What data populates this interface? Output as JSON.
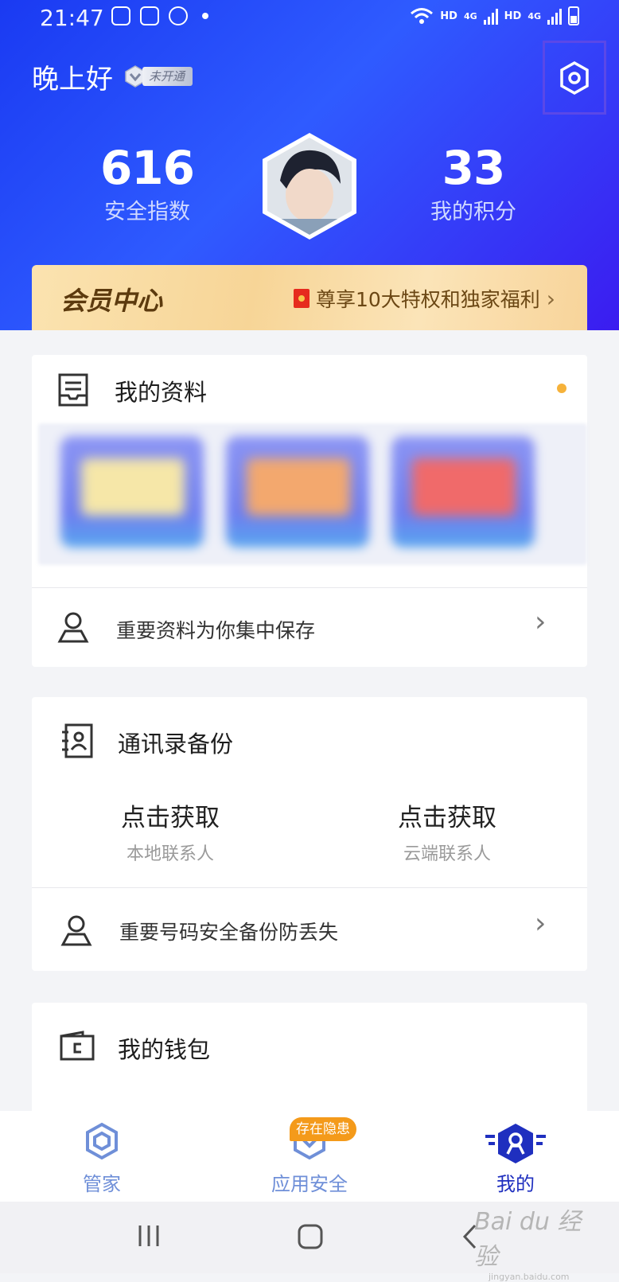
{
  "status_bar": {
    "time": "21:47",
    "network_labels": [
      "HD",
      "4G",
      "HD",
      "4G"
    ]
  },
  "header": {
    "greeting": "晚上好",
    "vip_status": "未开通",
    "settings_icon": "settings-hexagon-icon"
  },
  "stats": {
    "security_score": "616",
    "security_label": "安全指数",
    "points": "33",
    "points_label": "我的积分"
  },
  "member_banner": {
    "title": "会员中心",
    "promo": "尊享10大特权和独家福利",
    "chevron": "›"
  },
  "my_data_card": {
    "title": "我的资料",
    "row_text": "重要资料为你集中保存",
    "chevron": "›",
    "thumb_colors": [
      "#f6e7a8",
      "#f3a86e",
      "#f06a6a"
    ]
  },
  "contacts_card": {
    "title": "通讯录备份",
    "local_value": "点击获取",
    "local_label": "本地联系人",
    "cloud_value": "点击获取",
    "cloud_label": "云端联系人",
    "row_text": "重要号码安全备份防丢失",
    "chevron": "›"
  },
  "wallet_card": {
    "title": "我的钱包"
  },
  "bottom_nav": {
    "items": [
      {
        "label": "管家",
        "icon": "shield-hexagon-icon",
        "active": false
      },
      {
        "label": "应用安全",
        "icon": "app-security-icon",
        "active": false,
        "badge": "存在隐患"
      },
      {
        "label": "我的",
        "icon": "profile-badge-icon",
        "active": true
      }
    ],
    "inactive_color": "#6f8fd8",
    "active_color": "#1f2fbf"
  },
  "watermark": {
    "brand": "Bai du 经验",
    "url": "jingyan.baidu.com"
  }
}
